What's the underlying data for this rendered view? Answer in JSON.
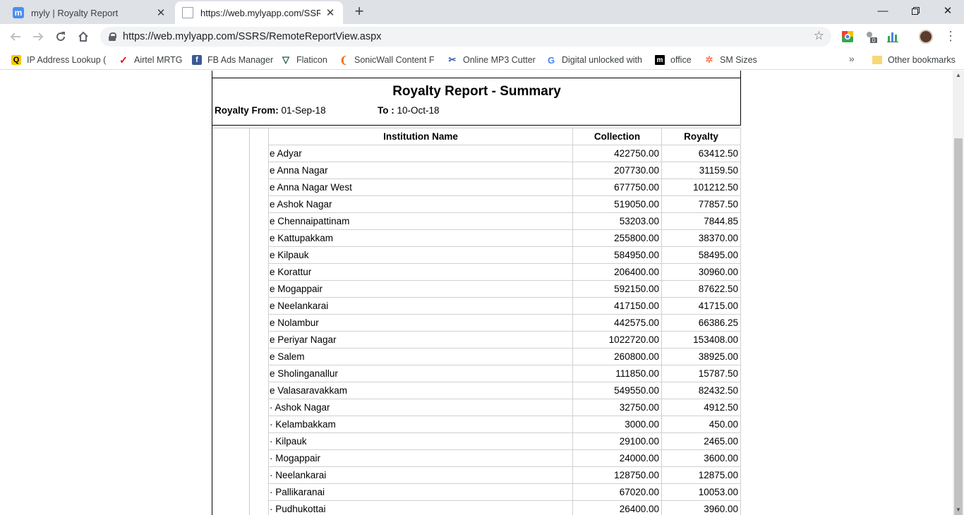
{
  "browser": {
    "tabs": [
      {
        "title": "myly | Royalty Report",
        "favicon": "m"
      },
      {
        "title": "https://web.mylyapp.com/SSRS/R",
        "favicon": "page"
      }
    ],
    "url": "https://web.mylyapp.com/SSRS/RemoteReportView.aspx",
    "extension_badge": "0",
    "bookmarks": [
      {
        "label": "IP Address Lookup (I",
        "icon": "ip-lookup-icon"
      },
      {
        "label": "Airtel MRTG",
        "icon": "airtel-icon"
      },
      {
        "label": "FB Ads Manager",
        "icon": "facebook-icon"
      },
      {
        "label": "Flaticon",
        "icon": "flaticon-icon"
      },
      {
        "label": "SonicWall Content Fil",
        "icon": "sonicwall-icon"
      },
      {
        "label": "Online MP3 Cutter",
        "icon": "scissors-icon"
      },
      {
        "label": "Digital unlocked with",
        "icon": "google-icon"
      },
      {
        "label": "office",
        "icon": "office-icon"
      },
      {
        "label": "SM Sizes",
        "icon": "hubspot-icon"
      }
    ],
    "other_bookmarks": "Other bookmarks"
  },
  "report": {
    "title": "Royalty Report - Summary",
    "from_label": "Royalty From:",
    "from_value": "01-Sep-18",
    "to_label": "To :",
    "to_value": "10-Oct-18",
    "columns": [
      "Institution Name",
      "Collection",
      "Royalty"
    ],
    "rows": [
      [
        "e Adyar",
        "422750.00",
        "63412.50"
      ],
      [
        "e Anna Nagar",
        "207730.00",
        "31159.50"
      ],
      [
        "e Anna Nagar West",
        "677750.00",
        "101212.50"
      ],
      [
        "e Ashok Nagar",
        "519050.00",
        "77857.50"
      ],
      [
        "e Chennaipattinam",
        "53203.00",
        "7844.85"
      ],
      [
        "e Kattupakkam",
        "255800.00",
        "38370.00"
      ],
      [
        "e Kilpauk",
        "584950.00",
        "58495.00"
      ],
      [
        "e Korattur",
        "206400.00",
        "30960.00"
      ],
      [
        "e Mogappair",
        "592150.00",
        "87622.50"
      ],
      [
        "e Neelankarai",
        "417150.00",
        "41715.00"
      ],
      [
        "e Nolambur",
        "442575.00",
        "66386.25"
      ],
      [
        "e Periyar Nagar",
        "1022720.00",
        "153408.00"
      ],
      [
        "e Salem",
        "260800.00",
        "38925.00"
      ],
      [
        "e Sholinganallur",
        "111850.00",
        "15787.50"
      ],
      [
        "e Valasaravakkam",
        "549550.00",
        "82432.50"
      ],
      [
        "· Ashok Nagar",
        "32750.00",
        "4912.50"
      ],
      [
        "· Kelambakkam",
        "3000.00",
        "450.00"
      ],
      [
        "· Kilpauk",
        "29100.00",
        "2465.00"
      ],
      [
        "· Mogappair",
        "24000.00",
        "3600.00"
      ],
      [
        "· Neelankarai",
        "128750.00",
        "12875.00"
      ],
      [
        "· Pallikaranai",
        "67020.00",
        "10053.00"
      ],
      [
        "· Pudhukottai",
        "26400.00",
        "3960.00"
      ]
    ]
  }
}
